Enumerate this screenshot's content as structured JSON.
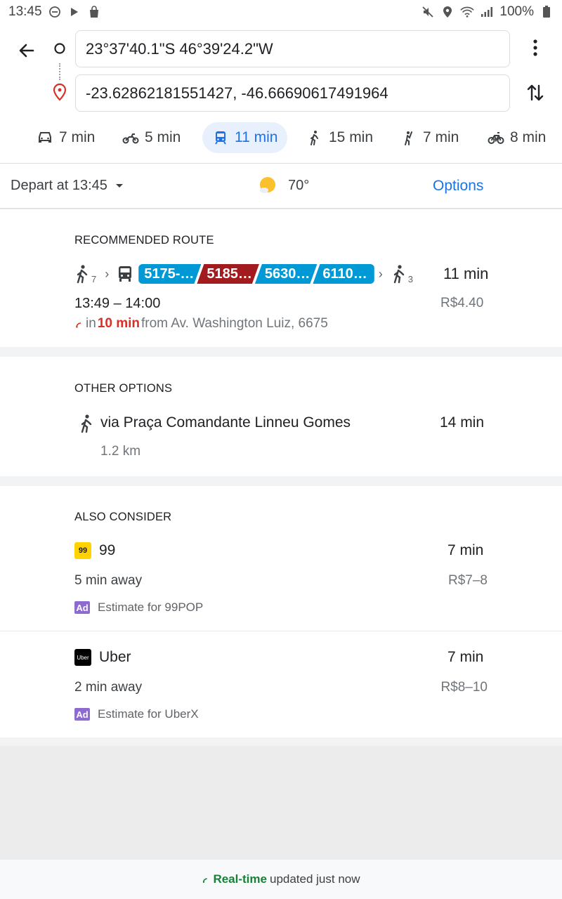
{
  "status_bar": {
    "time": "13:45",
    "battery": "100%"
  },
  "search": {
    "origin": "23°37'40.1\"S 46°39'24.2\"W",
    "destination": "-23.62862181551427, -46.66690617491964"
  },
  "modes": [
    {
      "icon": "car-icon",
      "label": "7 min"
    },
    {
      "icon": "motorcycle-icon",
      "label": "5 min"
    },
    {
      "icon": "transit-icon",
      "label": "11 min",
      "active": true
    },
    {
      "icon": "walk-icon",
      "label": "15 min"
    },
    {
      "icon": "ride-hail-icon",
      "label": "7 min"
    },
    {
      "icon": "bike-icon",
      "label": "8 min"
    }
  ],
  "depart": {
    "label": "Depart at 13:45",
    "temperature": "70°",
    "options_label": "Options"
  },
  "recommended": {
    "title": "RECOMMENDED ROUTE",
    "walk_start": "7",
    "walk_end": "3",
    "lines": [
      {
        "name": "5175-…",
        "color": "#0099d6"
      },
      {
        "name": "5185…",
        "color": "#a11b1f"
      },
      {
        "name": "5630…",
        "color": "#0099d6"
      },
      {
        "name": "6110…",
        "color": "#0099d6"
      }
    ],
    "duration": "11 min",
    "times": "13:49 – 14:00",
    "fare": "R$4.40",
    "departs_prefix": "in",
    "departs_in": "10 min",
    "departs_from": "from Av. Washington Luiz, 6675"
  },
  "other_options": {
    "title": "OTHER OPTIONS",
    "via": "via Praça Comandante Linneu Gomes",
    "duration": "14 min",
    "distance": "1.2 km"
  },
  "also_consider": {
    "title": "ALSO CONSIDER",
    "items": [
      {
        "logo": "99",
        "name": "99",
        "duration": "7 min",
        "away": "5 min away",
        "fare": "R$7–8",
        "ad": "Ad",
        "estimate": "Estimate for 99POP"
      },
      {
        "logo": "Uber",
        "name": "Uber",
        "duration": "7 min",
        "away": "2 min away",
        "fare": "R$8–10",
        "ad": "Ad",
        "estimate": "Estimate for UberX"
      }
    ]
  },
  "footer": {
    "realtime": "Real-time",
    "updated": "updated just now"
  }
}
